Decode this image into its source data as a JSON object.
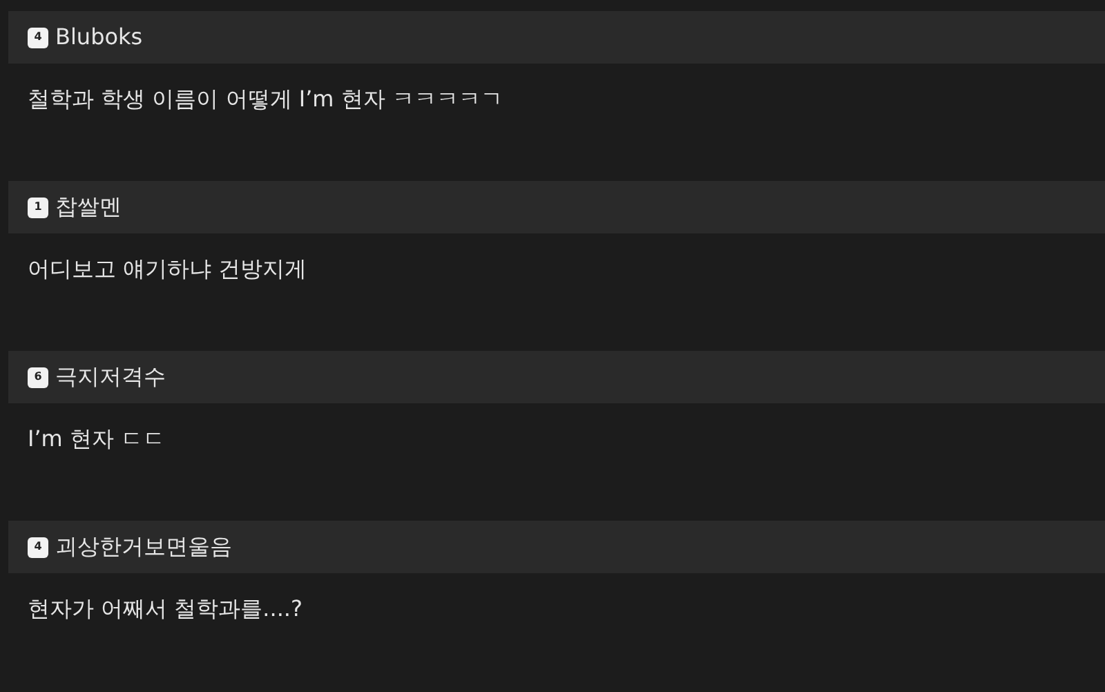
{
  "comments": [
    {
      "author": "Bluboks",
      "level_badge": "4",
      "text": "철학과 학생 이름이 어떻게 I’m 현자 ㅋㅋㅋㅋㄱ"
    },
    {
      "author": "찹쌀멘",
      "level_badge": "1",
      "text": "어디보고 얘기하냐 건방지게"
    },
    {
      "author": "극지저격수",
      "level_badge": "6",
      "text": "I’m 현자 ㄷㄷ"
    },
    {
      "author": "괴상한거보면울음",
      "level_badge": "4",
      "text": "현자가 어째서 철학과를....?"
    }
  ]
}
